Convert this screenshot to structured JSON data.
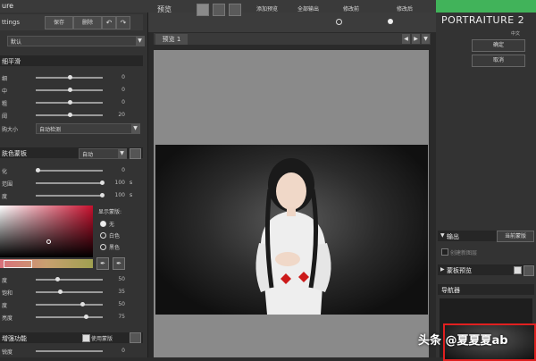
{
  "app": {
    "title_fragment": "ure",
    "brand": "PORTRAITURE 2",
    "brand_sub": "中文"
  },
  "left_top": {
    "settings_fragment": "ttings",
    "save_label": "保存",
    "delete_label": "删除",
    "preset_value": "默认"
  },
  "smoothing": {
    "title": "细平滑",
    "rows": [
      {
        "label": "细",
        "value": "0",
        "pos": 0.5
      },
      {
        "label": "中",
        "value": "0",
        "pos": 0.5
      },
      {
        "label": "粗",
        "value": "0",
        "pos": 0.5
      },
      {
        "label": "阈",
        "value": "20",
        "pos": 0.5
      }
    ],
    "size_label": "购大小",
    "size_value": "自动检测"
  },
  "skin_mask": {
    "title": "肤色蒙板",
    "mode_value": "自动",
    "rows": [
      {
        "label": "化",
        "value": "0",
        "pos": 0.0
      },
      {
        "label": "范围",
        "value": "100",
        "unit": "s",
        "pos": 1.0
      },
      {
        "label": "度",
        "value": "100",
        "unit": "s",
        "pos": 1.0
      }
    ],
    "display_label": "显示蒙版:",
    "radio_options": [
      "无",
      "白色",
      "黑色"
    ],
    "sliders2": [
      {
        "label": "度",
        "value": "50",
        "pos": 0.3
      },
      {
        "label": "饱和",
        "value": "35",
        "pos": 0.35
      },
      {
        "label": "度",
        "value": "50",
        "pos": 0.7
      },
      {
        "label": "亮度",
        "value": "75",
        "pos": 0.75
      }
    ]
  },
  "enhance": {
    "title": "增强功能",
    "checkbox_label": "使用蒙版",
    "row_label": "锐度",
    "row_value": "0"
  },
  "center": {
    "preview_label": "预览",
    "add_preview": "添加预览",
    "all_output": "全部输出",
    "before_label": "修改前",
    "after_label": "修改后",
    "tab1": "预览 1"
  },
  "right": {
    "ok_label": "确定",
    "cancel_label": "取消",
    "output_title": "输出",
    "output_btn": "当前蒙版",
    "output_option": "创建新图层",
    "mask_preview": "蒙板预览",
    "navigator": "导航器"
  },
  "watermark": "头条 @夏夏夏ab"
}
